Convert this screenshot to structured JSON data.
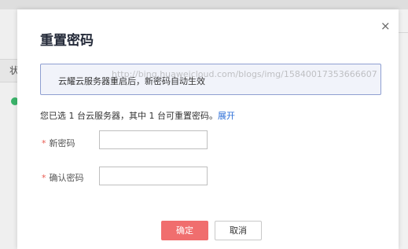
{
  "background": {
    "left_row_char": "状"
  },
  "dialog": {
    "title": "重置密码",
    "close_glyph": "×",
    "notice": "云耀云服务器重启后，新密码自动生效",
    "watermark": "http://bing.huaweicloud.com/blogs/img/15840017353666607",
    "summary_text": "您已选 1 台云服务器，其中 1 台可重置密码。",
    "summary_link": "展开",
    "fields": {
      "new_password": {
        "required_mark": "*",
        "label": "新密码",
        "value": ""
      },
      "confirm_password": {
        "required_mark": "*",
        "label": "确认密码",
        "value": ""
      }
    },
    "buttons": {
      "ok": "确定",
      "cancel": "取消"
    }
  },
  "colors": {
    "primary_button": "#f06e6e",
    "link": "#2d6fd8",
    "notice_border": "#8f9fd1",
    "required": "#e85a4f"
  }
}
